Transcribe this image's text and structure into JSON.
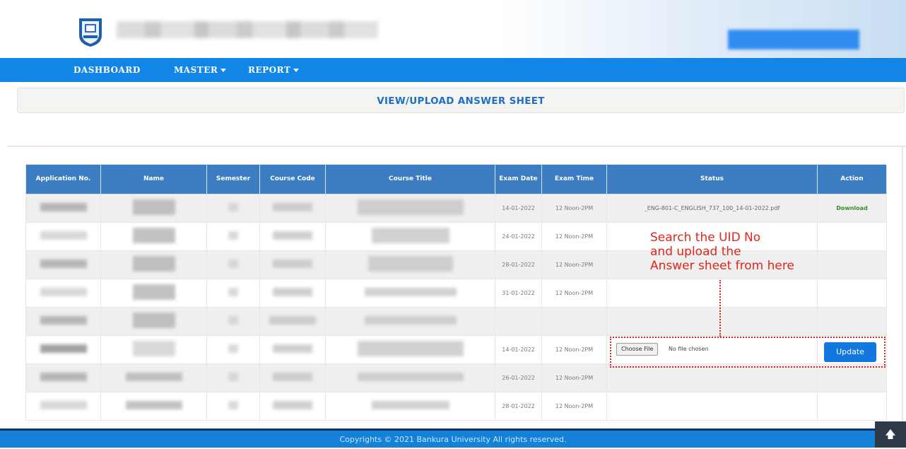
{
  "nav": {
    "items": [
      {
        "label": "DASHBOARD",
        "dropdown": false
      },
      {
        "label": "MASTER",
        "dropdown": true
      },
      {
        "label": "REPORT",
        "dropdown": true
      }
    ]
  },
  "page_title": "VIEW/UPLOAD ANSWER SHEET",
  "table": {
    "headers": [
      "Application No.",
      "Name",
      "Semester",
      "Course Code",
      "Course Title",
      "Exam Date",
      "Exam Time",
      "Status",
      "Action"
    ],
    "rows": [
      {
        "date": "14-01-2022",
        "time": "12 Noon-2PM",
        "status_file": "_ENG-801-C_ENGLISH_737_100_14-01-2022.pdf",
        "action": "Download"
      },
      {
        "date": "24-01-2022",
        "time": "12 Noon-2PM",
        "status_file": "",
        "action": ""
      },
      {
        "date": "28-01-2022",
        "time": "12 Noon-2PM",
        "status_file": "",
        "action": ""
      },
      {
        "date": "31-01-2022",
        "time": "12 Noon-2PM",
        "status_file": "",
        "action": ""
      },
      {
        "date": "",
        "time": "",
        "status_file": "",
        "action": ""
      },
      {
        "date": "14-01-2022",
        "time": "12 Noon-2PM",
        "status_file": "",
        "action": ""
      },
      {
        "date": "26-01-2022",
        "time": "12 Noon-2PM",
        "status_file": "",
        "action": ""
      },
      {
        "date": "28-01-2022",
        "time": "12 Noon-2PM",
        "status_file": "",
        "action": ""
      }
    ]
  },
  "upload": {
    "choose_file_label": "Choose File",
    "no_file_text": "No file chosen",
    "update_label": "Update"
  },
  "annotation": "Search the UID No\nand upload the\nAnswer sheet from here",
  "footer": "Copyrights © 2021 Bankura University All rights reserved.",
  "colors": {
    "nav": "#1286e6",
    "table_header": "#3b7cc2",
    "annotation": "#e0261c",
    "footer": "#1382d8"
  },
  "icons": {
    "logo": "university-logo",
    "scroll_top": "arrow-up-icon"
  }
}
